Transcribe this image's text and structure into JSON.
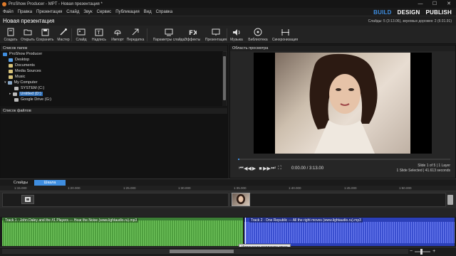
{
  "app": {
    "title": "ProShow Producer - MPT - Новая презентация *"
  },
  "window_buttons": {
    "minimize": "—",
    "maximize": "☐",
    "close": "✕"
  },
  "menu": [
    "Файл",
    "Правка",
    "Презентация",
    "Слайд",
    "Звук",
    "Сервис",
    "Публикация",
    "Вид",
    "Справка"
  ],
  "modes": [
    "BUILD",
    "DESIGN",
    "PUBLISH"
  ],
  "active_mode": "BUILD",
  "project": {
    "name": "Новая презентация",
    "info": "Слайды: 5 (3:13.06), звуковых дорожек: 2 (6:31.91)"
  },
  "toolbar": [
    {
      "label": "Создать",
      "icon": "new-icon"
    },
    {
      "label": "Открыть",
      "icon": "open-icon"
    },
    {
      "label": "Сохранить",
      "icon": "save-icon"
    },
    {
      "label": "Мастер",
      "icon": "wizard-icon"
    },
    {
      "label": "Слайд",
      "icon": "slide-icon"
    },
    {
      "label": "Надпись",
      "icon": "caption-icon"
    },
    {
      "label": "Импорт",
      "icon": "import-icon"
    },
    {
      "label": "Передатка",
      "icon": "transfer-icon"
    },
    {
      "label": "Параметры слайда",
      "icon": "slide-options-icon"
    },
    {
      "label": "Эффекты",
      "icon": "fx-icon"
    },
    {
      "label": "Презентация",
      "icon": "presentation-icon"
    },
    {
      "label": "Музыка",
      "icon": "music-icon"
    },
    {
      "label": "Библиотека",
      "icon": "library-icon"
    },
    {
      "label": "Синхронизация",
      "icon": "sync-icon"
    }
  ],
  "folders": {
    "title": "Список папок",
    "items": [
      {
        "label": "ProShow Producer",
        "level": 0,
        "selected": false,
        "color": "#3f8ee0"
      },
      {
        "label": "Desktop",
        "level": 1,
        "selected": false,
        "color": "#5aa0e8"
      },
      {
        "label": "Documents",
        "level": 1,
        "selected": false,
        "color": "#d9c47a"
      },
      {
        "label": "Media Sources",
        "level": 1,
        "selected": false,
        "color": "#d9c47a"
      },
      {
        "label": "Music",
        "level": 1,
        "selected": false,
        "color": "#d9c47a"
      },
      {
        "label": "My Computer",
        "level": 1,
        "selected": false,
        "color": "#8aa8c8"
      },
      {
        "label": "SYSTEM (C:)",
        "level": 2,
        "selected": false,
        "color": "#bbbbbb"
      },
      {
        "label": "Untitled (D:)",
        "level": 2,
        "selected": true,
        "color": "#bbbbbb"
      },
      {
        "label": "Google Drive (G:)",
        "level": 2,
        "selected": false,
        "color": "#bbbbbb"
      }
    ]
  },
  "files": {
    "title": "Список файлов"
  },
  "preview": {
    "title": "Область просмотра",
    "time": "0:00.00 / 3:13.00",
    "slide_info": [
      "Slide 1 of 5  |  1 Layer",
      "1 Slide Selected  |  41.613 seconds"
    ],
    "progress": 0.0
  },
  "tabs": [
    {
      "label": "Слайды",
      "active": false
    },
    {
      "label": "Шкала",
      "active": true
    }
  ],
  "ruler": [
    "1:15.000",
    "1:20.000",
    "1:25.000",
    "1:30.000",
    "1:35.000",
    "1:40.000",
    "1:45.000",
    "1:50.000"
  ],
  "audio": {
    "track1": "Track 1 - John Daley and the #1 Players — Hear the Noise (www.lightaudio.ru).mp3",
    "track2": "Track 2 - One Republic — All the right moves (www.lightaudio.ru).mp3",
    "tooltip": "Изменение громкости звука",
    "track1_color": "#4fa03f",
    "track2_color": "#3a4fd0"
  },
  "zoom": {
    "minus": "−",
    "plus": "+",
    "value": 0.4
  }
}
